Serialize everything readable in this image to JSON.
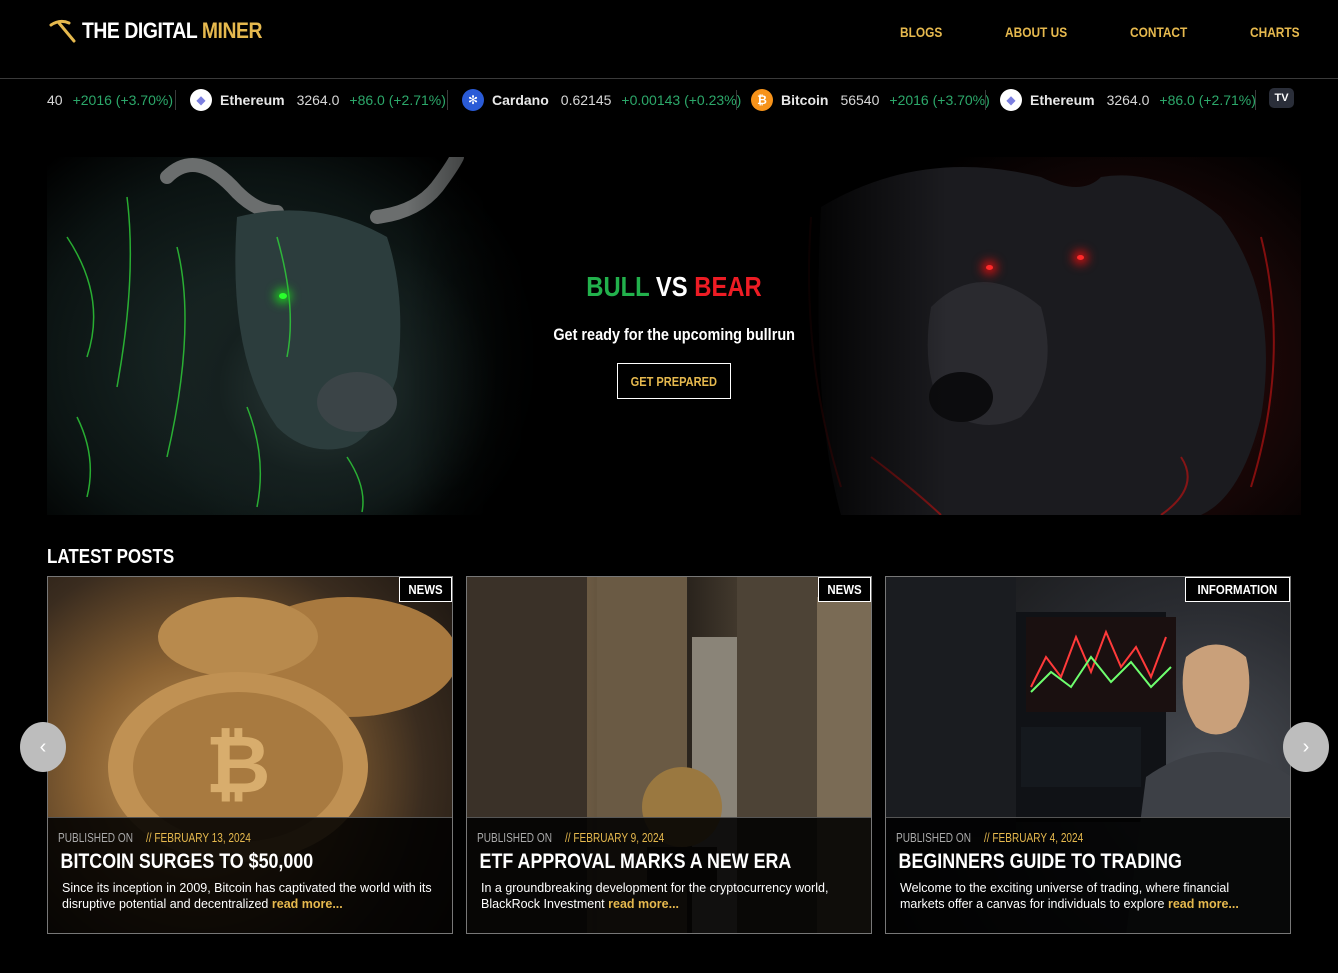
{
  "header": {
    "brand_part1": "THE DIGITAL",
    "brand_part2": "MINER",
    "nav": [
      "BLOGS",
      "ABOUT US",
      "CONTACT",
      "CHARTS"
    ]
  },
  "ticker": {
    "items": [
      {
        "name": "",
        "price": "40",
        "change": "+2016 (+3.70%)",
        "icon": "bitcoin-icon"
      },
      {
        "name": "Ethereum",
        "price": "3264.0",
        "change": "+86.0 (+2.71%)",
        "icon": "ethereum-icon"
      },
      {
        "name": "Cardano",
        "price": "0.62145",
        "change": "+0.00143 (+0.23%)",
        "icon": "cardano-icon"
      },
      {
        "name": "Bitcoin",
        "price": "56540",
        "change": "+2016 (+3.70%)",
        "icon": "bitcoin-icon"
      },
      {
        "name": "Ethereum",
        "price": "3264.0",
        "change": "+86.0 (+2.71%)",
        "icon": "ethereum-icon"
      }
    ],
    "badge": "TV"
  },
  "hero": {
    "bull": "BULL",
    "vs": "VS",
    "bear": "BEAR",
    "subtitle": "Get ready for the upcoming bullrun",
    "button": "GET PREPARED"
  },
  "posts": {
    "title": "LATEST POSTS",
    "published_label": "PUBLISHED ON",
    "read_more": "read more...",
    "items": [
      {
        "category": "NEWS",
        "date": "// FEBRUARY 13, 2024",
        "title": "BITCOIN SURGES TO $50,000",
        "excerpt": "Since its inception in 2009, Bitcoin has captivated the world with its disruptive potential and decentralized"
      },
      {
        "category": "NEWS",
        "date": "// FEBRUARY 9, 2024",
        "title": "ETF APPROVAL MARKS A NEW ERA",
        "excerpt": "In a groundbreaking development for the cryptocurrency world, BlackRock Investment"
      },
      {
        "category": "INFORMATION",
        "date": "// FEBRUARY 4, 2024",
        "title": "BEGINNERS GUIDE TO TRADING",
        "excerpt": "Welcome to the exciting universe of trading, where financial markets offer a canvas for individuals to explore"
      }
    ]
  },
  "carousel": {
    "prev": "‹",
    "next": "›"
  },
  "colors": {
    "gold": "#e6b94e",
    "green": "#22b14c",
    "red": "#ed1c24",
    "ticker_green": "#2ca86a"
  }
}
